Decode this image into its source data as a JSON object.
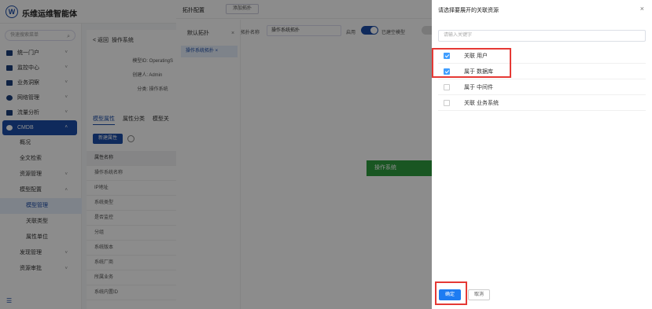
{
  "app": {
    "logo_glyph": "W",
    "brand": "乐维运维智能体"
  },
  "sidebar": {
    "search_placeholder": "快速搜索菜单",
    "menu": [
      {
        "label": "统一门户",
        "icon": "home-icon"
      },
      {
        "label": "监控中心",
        "icon": "monitor-icon"
      },
      {
        "label": "业务洞察",
        "icon": "insight-icon"
      },
      {
        "label": "网络管理",
        "icon": "network-icon"
      },
      {
        "label": "流量分析",
        "icon": "traffic-icon"
      }
    ],
    "cmdb": {
      "label": "CMDB",
      "icon": "cmdb-icon"
    },
    "sub": [
      "概况",
      "全文检索",
      "资源管理",
      "模型配置",
      "模型管理",
      "关联类型",
      "属性单位",
      "发现管理",
      "资源审批"
    ],
    "footer_icon": "menu-collapse-icon"
  },
  "main": {
    "back": "< 返回",
    "title": "操作系统",
    "info": [
      {
        "k": "模型ID:",
        "v": "OperatingS"
      },
      {
        "k": "创建人:",
        "v": "Admin"
      },
      {
        "k": "分类:",
        "v": "操作系统"
      }
    ],
    "tabs": [
      "模型属性",
      "属性分类",
      "模型关"
    ],
    "new_attr": "新建属性",
    "table_head": "属性名称",
    "rows": [
      "操作系统名称",
      "IP地址",
      "系统类型",
      "是否监控",
      "分组",
      "系统版本",
      "系统厂商",
      "所属业务",
      "系统内置ID"
    ]
  },
  "topo": {
    "title": "拓扑配置",
    "add": "添加拓扑",
    "default_label": "默认拓扑",
    "tab": "操作系统拓扑 ×",
    "close": "×",
    "name_label": "拓扑名称",
    "name_value": "操作系统拓扑",
    "enabled_label": "启用",
    "hide_empty_label": "已建空模型",
    "node": "操作系统"
  },
  "drawer": {
    "title": "请选择要展开的关联资源",
    "close": "×",
    "search_placeholder": "请输入关键字",
    "items": [
      {
        "label": "关联 用户",
        "checked": true
      },
      {
        "label": "属于 数据库",
        "checked": true
      },
      {
        "label": "属于 中间件",
        "checked": false
      },
      {
        "label": "关联 业务系统",
        "checked": false
      }
    ],
    "ok": "确定",
    "cancel": "取消",
    "highlight_color": "#e53935"
  }
}
